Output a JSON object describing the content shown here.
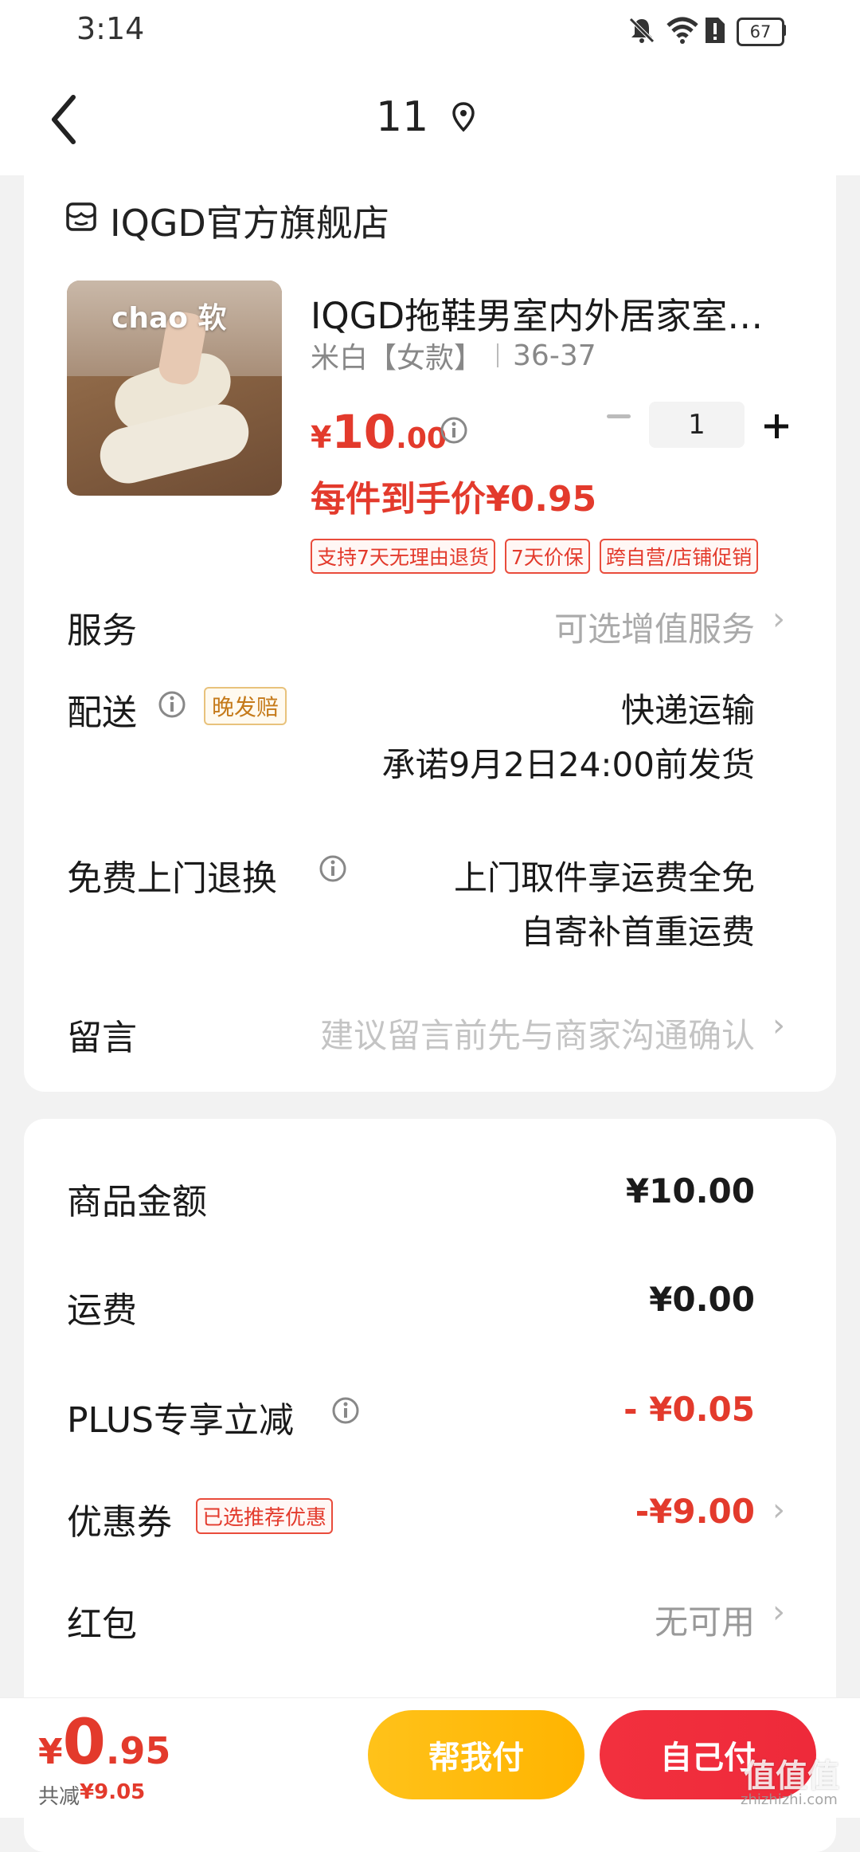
{
  "status_bar": {
    "time": "3:14",
    "battery": "67"
  },
  "header": {
    "title": "11"
  },
  "store": {
    "name": "IQGD官方旗舰店"
  },
  "product": {
    "image_text": "chao 软",
    "title": "IQGD拖鞋男室内外居家室…",
    "variant": "米白【女款】",
    "size": "36-37",
    "price_symbol": "¥",
    "price_int": "10",
    "price_dec": ".00",
    "quantity": "1",
    "per_item_price": "每件到手价¥0.95",
    "tags": [
      "支持7天无理由退货",
      "7天价保",
      "跨自营/店铺促销"
    ]
  },
  "service": {
    "label": "服务",
    "value": "可选增值服务"
  },
  "delivery": {
    "label": "配送",
    "badge": "晚发赔",
    "method": "快递运输",
    "promise": "承诺9月2日24:00前发货"
  },
  "return": {
    "label": "免费上门退换",
    "line1": "上门取件享运费全免",
    "line2": "自寄补首重运费"
  },
  "message": {
    "label": "留言",
    "placeholder": "建议留言前先与商家沟通确认"
  },
  "summary": {
    "goods_label": "商品金额",
    "goods_value": "¥10.00",
    "shipping_label": "运费",
    "shipping_value": "¥0.00",
    "plus_label": "PLUS专享立减",
    "plus_value": "- ¥0.05",
    "coupon_label": "优惠券",
    "coupon_badge": "已选推荐优惠",
    "coupon_value": "-¥9.00",
    "redpacket_label": "红包",
    "redpacket_value": "无可用"
  },
  "bottom": {
    "total_symbol": "¥",
    "total_int": "0",
    "total_dec": ".95",
    "saved_label": "共减",
    "saved_value": "¥9.05",
    "help_pay": "帮我付",
    "self_pay": "自己付",
    "watermark": "值值值",
    "watermark_url": "zhizhizhi.com"
  },
  "colors": {
    "price_red": "#e33a2c",
    "help_btn": "#ffc21a",
    "self_btn": "#f2303e",
    "badge_orange": "#c57a1a"
  }
}
